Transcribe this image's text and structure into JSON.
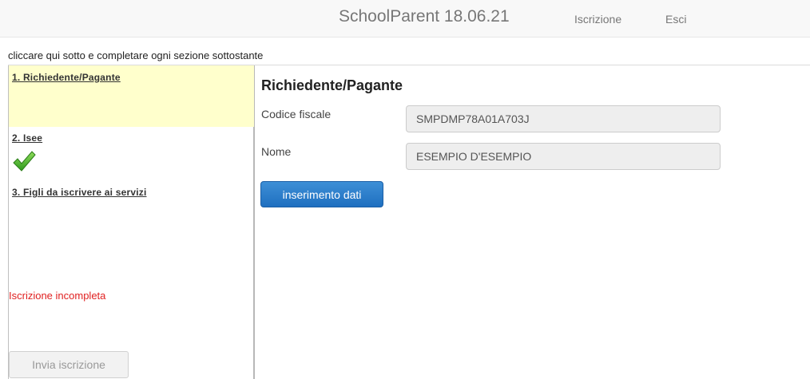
{
  "navbar": {
    "brand": "SchoolParent 18.06.21",
    "links": [
      "Iscrizione",
      "Esci"
    ]
  },
  "instructions": "cliccare qui sotto e completare ogni sezione sottostante",
  "sidebar": {
    "steps": [
      {
        "label": "1. Richiedente/Pagante",
        "active": true
      },
      {
        "label": "2. Isee",
        "completed": true,
        "icon": "checkmark-icon"
      },
      {
        "label": "3. Figli da iscrivere ai servizi"
      }
    ],
    "status": "Iscrizione incompleta",
    "status_color": "#e02020",
    "send_button": "Invia iscrizione"
  },
  "main": {
    "title": "Richiedente/Pagante",
    "fields": [
      {
        "label": "Codice fiscale",
        "value": "SMPDMP78A01A703J"
      },
      {
        "label": "Nome",
        "value": "ESEMPIO D'ESEMPIO"
      }
    ],
    "submit_button": "inserimento dati",
    "accent": "#1f6fc0"
  }
}
